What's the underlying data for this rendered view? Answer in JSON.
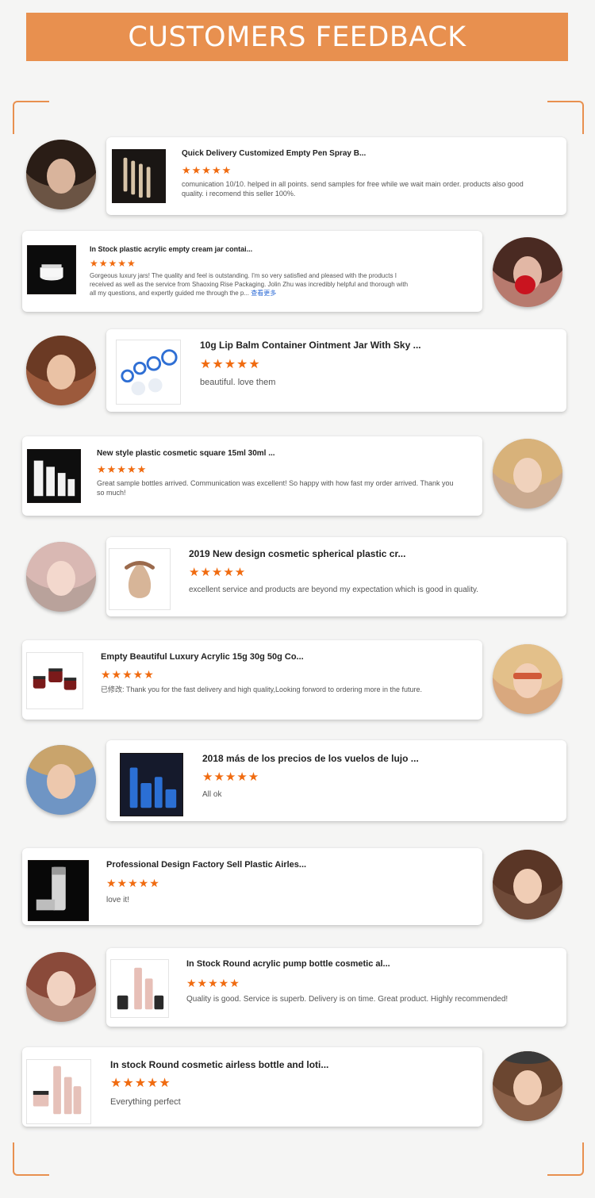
{
  "header": {
    "title": "CUSTOMERS FEEDBACK"
  },
  "reviews": [
    {
      "title": "Quick Delivery Customized Empty Pen Spray B...",
      "stars": "★★★★★",
      "comment": "comunication 10/10. helped in all points. send samples for free while we wait main order. products also good quality. i recomend this seller 100%.",
      "product_icon": "pen-spray-bottles-icon",
      "avatar_icon": "woman-avatar"
    },
    {
      "title": "In Stock plastic acrylic empty cream jar contai...",
      "stars": "★★★★★",
      "comment": "Gorgeous luxury jars! The quality and feel is outstanding. I'm so very satisfied and pleased with the products I received as well as the service from Shaoxing Rise Packaging. Jolin Zhu was incredibly helpful and thorough with all my questions, and expertly guided me through the p...",
      "more": "查看更多",
      "product_icon": "cream-jar-icon",
      "avatar_icon": "woman-with-rose-avatar"
    },
    {
      "title": "10g Lip Balm Container Ointment Jar With Sky ...",
      "stars": "★★★★★",
      "comment": "beautiful. love them",
      "product_icon": "lip-balm-jars-icon",
      "avatar_icon": "smiling-woman-avatar"
    },
    {
      "title": "New style plastic cosmetic square 15ml 30ml ...",
      "stars": "★★★★★",
      "comment": "Great sample bottles arrived. Communication was excellent! So happy with how fast my order arrived. Thank you so much!",
      "product_icon": "square-bottles-icon",
      "avatar_icon": "blonde-woman-avatar"
    },
    {
      "title": "2019 New design cosmetic spherical plastic cr...",
      "stars": "★★★★★",
      "comment": "excellent service and products are beyond my expectation which is good in quality.",
      "product_icon": "spherical-jar-icon",
      "avatar_icon": "woman-avatar"
    },
    {
      "title": "Empty Beautiful Luxury Acrylic 15g 30g 50g Co...",
      "stars": "★★★★★",
      "comment": "已修改: Thank you for the fast delivery and high quality,Looking forword to ordering more in the future.",
      "product_icon": "acrylic-jars-icon",
      "avatar_icon": "woman-sunglasses-avatar"
    },
    {
      "title": "2018 más de los precios de los vuelos de lujo ...",
      "stars": "★★★★★",
      "comment": "All ok",
      "product_icon": "blue-bottles-icon",
      "avatar_icon": "woman-hat-avatar"
    },
    {
      "title": "Professional Design Factory Sell Plastic Airles...",
      "stars": "★★★★★",
      "comment": "love it!",
      "product_icon": "airless-bottle-icon",
      "avatar_icon": "laughing-woman-avatar"
    },
    {
      "title": "In Stock Round acrylic pump bottle cosmetic al...",
      "stars": "★★★★★",
      "comment": "Quality is good. Service is superb. Delivery is on time. Great product. Highly recommended!",
      "product_icon": "pink-pump-bottles-icon",
      "avatar_icon": "woman-avatar"
    },
    {
      "title": "In stock Round cosmetic airless bottle and loti...",
      "stars": "★★★★★",
      "comment": "Everything perfect",
      "product_icon": "pink-airless-bottles-icon",
      "avatar_icon": "woman-avatar"
    }
  ]
}
